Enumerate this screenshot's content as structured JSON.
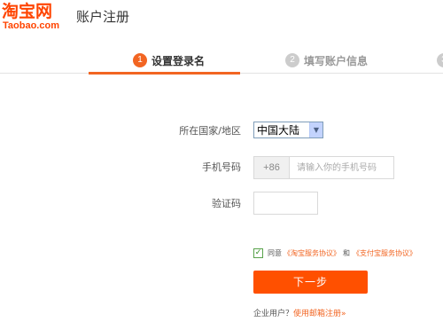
{
  "header": {
    "logo_cn": "淘宝网",
    "logo_en": "Taobao.com",
    "title": "账户注册"
  },
  "steps": [
    {
      "number": "1",
      "label": "设置登录名",
      "state": "active"
    },
    {
      "number": "2",
      "label": "填写账户信息",
      "state": "inactive"
    },
    {
      "number": "3",
      "label": "",
      "state": "inactive"
    }
  ],
  "form": {
    "region_label": "所在国家/地区",
    "region_value": "中国大陆",
    "phone_label": "手机号码",
    "phone_prefix": "+86",
    "phone_placeholder": "请输入你的手机号码",
    "code_label": "验证码"
  },
  "agreement": {
    "agree": "同意",
    "taobao_terms": "《淘宝服务协议》",
    "and": "和",
    "alipay_terms": "《支付宝服务协议》"
  },
  "next_button": "下一步",
  "enterprise": {
    "prompt": "企业用户？",
    "link": "使用邮箱注册»"
  },
  "colors": {
    "accent": "#ff5000",
    "step_active": "#f26522",
    "step_inactive": "#cccccc"
  }
}
